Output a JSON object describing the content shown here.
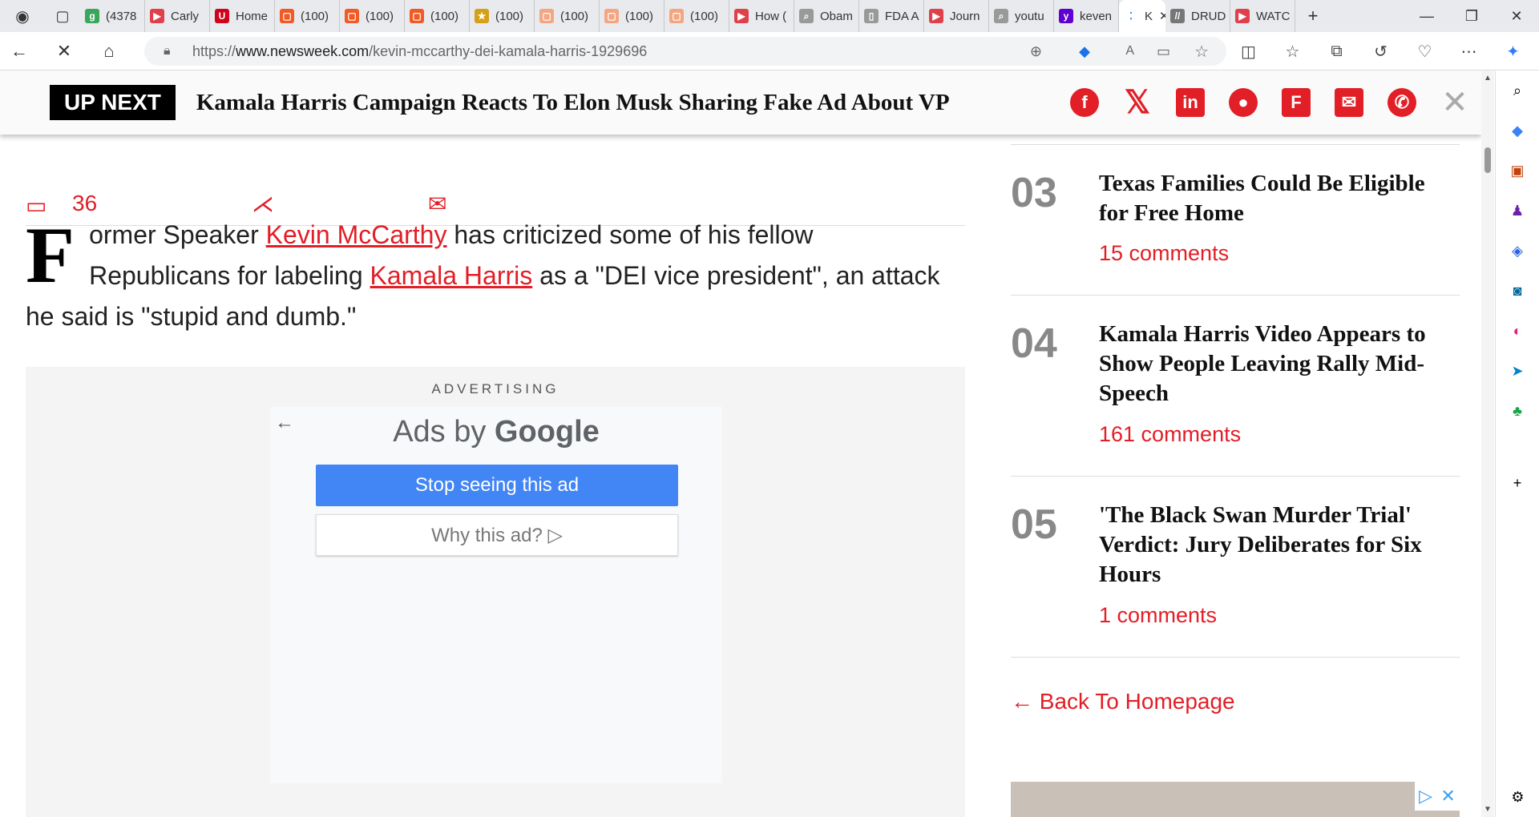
{
  "browser": {
    "tabs": [
      {
        "label": "(4378",
        "fav_color": "#3ba55c",
        "fav_char": "g"
      },
      {
        "label": "Carly",
        "fav_color": "#e0404a",
        "fav_char": "▶"
      },
      {
        "label": "Home",
        "fav_color": "#d0021b",
        "fav_char": "U"
      },
      {
        "label": "(100)",
        "fav_color": "#f15a24",
        "fav_char": "▢"
      },
      {
        "label": "(100)",
        "fav_color": "#f15a24",
        "fav_char": "▢"
      },
      {
        "label": "(100)",
        "fav_color": "#f15a24",
        "fav_char": "▢"
      },
      {
        "label": "(100)",
        "fav_color": "#d4a017",
        "fav_char": "★"
      },
      {
        "label": "(100)",
        "fav_color": "#f4a582",
        "fav_char": "▢"
      },
      {
        "label": "(100)",
        "fav_color": "#f4a582",
        "fav_char": "▢"
      },
      {
        "label": "(100)",
        "fav_color": "#f4a582",
        "fav_char": "▢"
      },
      {
        "label": "How (",
        "fav_color": "#e0404a",
        "fav_char": "▶"
      },
      {
        "label": "Obam",
        "fav_color": "#999999",
        "fav_char": "⌕"
      },
      {
        "label": "FDA A",
        "fav_color": "#999999",
        "fav_char": "▯"
      },
      {
        "label": "Journ",
        "fav_color": "#e0404a",
        "fav_char": "▶"
      },
      {
        "label": "youtu",
        "fav_color": "#999999",
        "fav_char": "⌕"
      },
      {
        "label": "keven",
        "fav_color": "#5f01d1",
        "fav_char": "y"
      },
      {
        "label": "K",
        "fav_color": "#ffffff",
        "fav_char": "⁚"
      },
      {
        "label": "DRUD",
        "fav_color": "#777777",
        "fav_char": "//"
      },
      {
        "label": "WATC",
        "fav_color": "#e0404a",
        "fav_char": "▶"
      }
    ],
    "url_prefix": "https://",
    "url_host": "www.newsweek.com",
    "url_path": "/kevin-mccarthy-dei-kamala-harris-1929696"
  },
  "upnext": {
    "label": "UP NEXT",
    "headline": "Kamala Harris Campaign Reacts To Elon Musk Sharing Fake Ad About VP"
  },
  "meta": {
    "comment_count": "36"
  },
  "article": {
    "dropcap": "F",
    "text_1": "ormer Speaker ",
    "link_1": "Kevin McCarthy",
    "text_2": " has criticized some of his fellow Republicans for labeling ",
    "link_2": "Kamala Harris",
    "text_3": " as a \"DEI vice president\", an attack he said is \"stupid and dumb.\""
  },
  "ad": {
    "label": "ADVERTISING",
    "ads_by": "Ads by ",
    "google": "Google",
    "stop_label": "Stop seeing this ad",
    "why_label": "Why this ad? ▷"
  },
  "rail": {
    "items": [
      {
        "num": "03",
        "title": "Texas Families Could Be Eligible for Free Home",
        "comments": "15 comments"
      },
      {
        "num": "04",
        "title": "Kamala Harris Video Appears to Show People Leaving Rally Mid-Speech",
        "comments": "161 comments"
      },
      {
        "num": "05",
        "title": "'The Black Swan Murder Trial' Verdict: Jury Deliberates for Six Hours",
        "comments": "1 comments"
      }
    ],
    "back_home": "← Back To Homepage"
  },
  "colors": {
    "accent": "#e21e26",
    "google_blue": "#4285f4"
  }
}
